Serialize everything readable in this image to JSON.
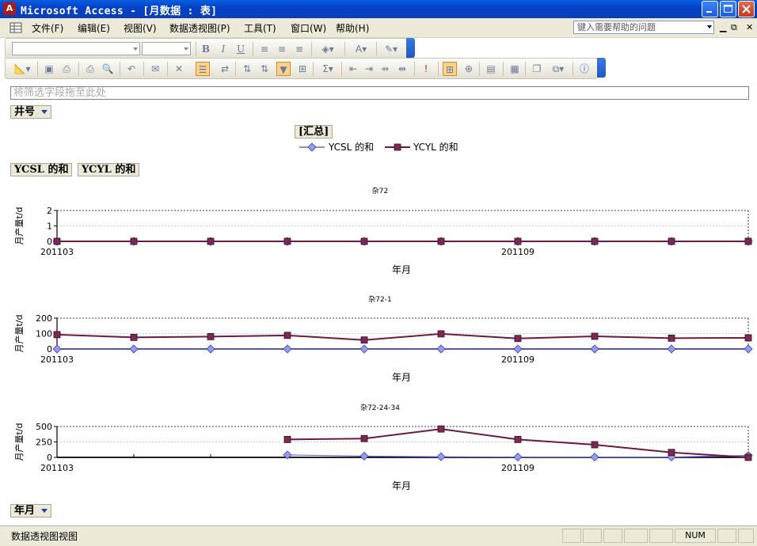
{
  "window": {
    "title": "Microsoft Access - [月数据 : 表]",
    "app_icon": "access-icon"
  },
  "menubar": {
    "items": [
      "文件(F)",
      "编辑(E)",
      "视图(V)",
      "数据透视图(P)",
      "工具(T)",
      "窗口(W)",
      "帮助(H)"
    ],
    "help_placeholder": "键入需要帮助的问题"
  },
  "toolbar_format": {
    "buttons": [
      "bold-icon",
      "italic-icon",
      "underline-icon",
      "align-left-icon",
      "align-center-icon",
      "align-right-icon",
      "fill-color-icon",
      "font-color-icon",
      "line-color-icon"
    ],
    "bold_label": "B",
    "italic_label": "I",
    "underline_label": "U",
    "font_color_label": "A"
  },
  "toolbar_main": {
    "buttons": [
      "design-view-icon",
      "save-icon",
      "print-preview-icon",
      "print-icon",
      "preview-icon",
      "undo-icon",
      "chart-icon",
      "delete-icon",
      "field-list-icon",
      "drill-icon",
      "sort-asc-icon",
      "sort-desc-icon",
      "autofilter-icon",
      "show-top-icon",
      "autocalc-icon",
      "subtotal-icon",
      "expand-icon",
      "collapse-icon",
      "hide-details-icon",
      "show-details-icon",
      "refresh-icon",
      "chart-type-icon",
      "drop-areas-icon",
      "legend-icon",
      "properties-icon",
      "window-icon",
      "new-object-icon",
      "help-icon"
    ],
    "sigma_label": "Σ"
  },
  "pivot": {
    "filter_drop_placeholder": "将筛选字段拖至此处",
    "filter_field": "井号",
    "category_field": "年月",
    "data_fields": [
      "YCSL 的和",
      "YCYL 的和"
    ],
    "series_title": "[汇总]",
    "legend": [
      "YCSL 的和",
      "YCYL 的和"
    ]
  },
  "colors": {
    "ycsl": "#6666dd",
    "ycsl_marker": "#9999ee",
    "ycyl": "#6b1a45",
    "ycyl_marker": "#7a2a55"
  },
  "chart_data": [
    {
      "type": "line",
      "title": "杂72",
      "xlabel": "年月",
      "ylabel": "月产量t/d",
      "x": [
        "201103",
        "201104",
        "201105",
        "201106",
        "201107",
        "201108",
        "201109",
        "201110",
        "201111",
        "201112"
      ],
      "x_tick_labels": [
        "201103",
        "201109"
      ],
      "ylim": [
        0,
        2
      ],
      "yticks": [
        0,
        1,
        2
      ],
      "series": [
        {
          "name": "YCSL 的和",
          "values": [
            0,
            0,
            0,
            0,
            0,
            0,
            0,
            0,
            0,
            0
          ]
        },
        {
          "name": "YCYL 的和",
          "values": [
            0,
            0,
            0,
            0,
            0,
            0,
            0,
            0,
            0,
            0
          ]
        }
      ]
    },
    {
      "type": "line",
      "title": "杂72-1",
      "xlabel": "年月",
      "ylabel": "月产量t/d",
      "x": [
        "201103",
        "201104",
        "201105",
        "201106",
        "201107",
        "201108",
        "201109",
        "201110",
        "201111",
        "201112"
      ],
      "x_tick_labels": [
        "201103",
        "201109"
      ],
      "ylim": [
        0,
        200
      ],
      "yticks": [
        0,
        100,
        200
      ],
      "series": [
        {
          "name": "YCSL 的和",
          "values": [
            0,
            0,
            0,
            0,
            0,
            0,
            0,
            0,
            0,
            0
          ]
        },
        {
          "name": "YCYL 的和",
          "values": [
            93,
            75,
            80,
            88,
            58,
            98,
            68,
            82,
            70,
            72
          ]
        }
      ]
    },
    {
      "type": "line",
      "title": "杂72-24-34",
      "xlabel": "年月",
      "ylabel": "月产量t/d",
      "x": [
        "201103",
        "201104",
        "201105",
        "201106",
        "201107",
        "201108",
        "201109",
        "201110",
        "201111",
        "201112"
      ],
      "x_tick_labels": [
        "201103",
        "201109"
      ],
      "ylim": [
        0,
        500
      ],
      "yticks": [
        0,
        250,
        500
      ],
      "series": [
        {
          "name": "YCSL 的和",
          "values": [
            null,
            null,
            null,
            40,
            20,
            10,
            5,
            5,
            5,
            30
          ]
        },
        {
          "name": "YCYL 的和",
          "values": [
            null,
            null,
            null,
            290,
            305,
            460,
            290,
            205,
            80,
            0
          ]
        }
      ]
    }
  ],
  "statusbar": {
    "mode_text": "数据透视图视图",
    "num_indicator": "NUM"
  }
}
